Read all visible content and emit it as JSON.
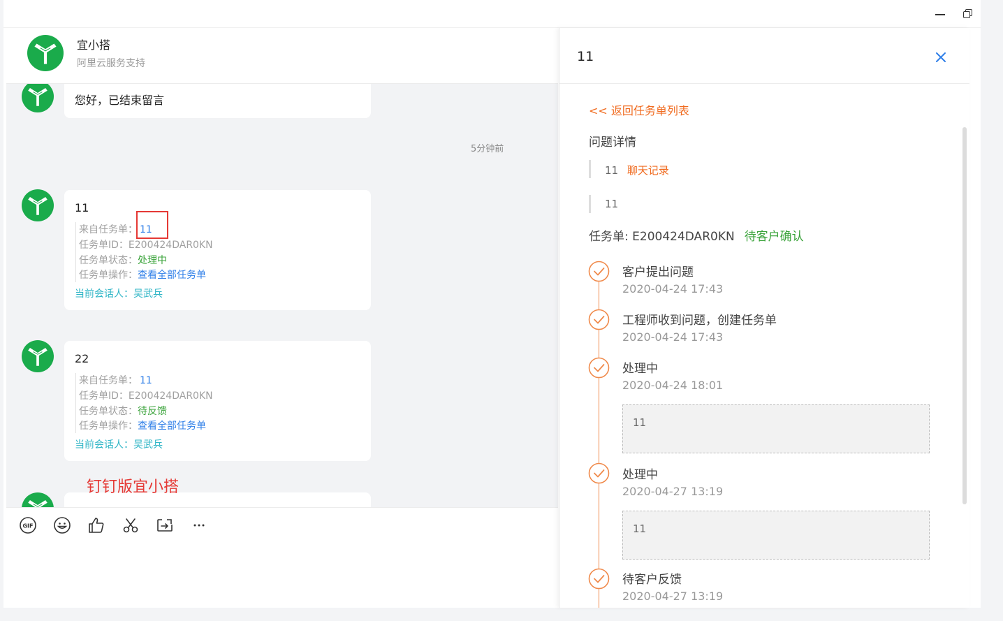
{
  "chat": {
    "header": {
      "name": "宜小搭",
      "subtitle": "阿里云服务支持"
    },
    "messages": [
      {
        "text": "您好，已结束留言"
      }
    ],
    "timestamp": "5分钟前",
    "cards": [
      {
        "title": "11",
        "from_label": "来自任务单：",
        "from_value": "11",
        "id_label": "任务单ID：",
        "id_value": "E200424DAR0KN",
        "status_label": "任务单状态：",
        "status_value": "处理中",
        "op_label": "任务单操作：",
        "op_value": "查看全部任务单",
        "speaker_label": "当前会话人：",
        "speaker_value": "吴武兵"
      },
      {
        "title": "22",
        "from_label": "来自任务单：",
        "from_value": "11",
        "id_label": "任务单ID：",
        "id_value": "E200424DAR0KN",
        "status_label": "任务单状态：",
        "status_value": "待反馈",
        "op_label": "任务单操作：",
        "op_value": "查看全部任务单",
        "speaker_label": "当前会话人：",
        "speaker_value": "吴武兵"
      }
    ],
    "watermark": "钉钉版宜小搭",
    "toolbar": [
      "gif-icon",
      "emoji-icon",
      "thumbs-up-icon",
      "scissors-icon",
      "forward-icon",
      "more-icon"
    ]
  },
  "detail": {
    "title": "11",
    "back_link": "<< 返回任务单列表",
    "section_title": "问题详情",
    "question_lines": [
      {
        "text": "11",
        "link": "聊天记录"
      },
      {
        "text": "11"
      }
    ],
    "task_label": "任务单: E200424DAR0KN",
    "task_status": "待客户确认",
    "timeline": [
      {
        "title": "客户提出问题",
        "time": "2020-04-24 17:43"
      },
      {
        "title": "工程师收到问题，创建任务单",
        "time": "2020-04-24 17:43"
      },
      {
        "title": "处理中",
        "time": "2020-04-24 18:01",
        "note": "11"
      },
      {
        "title": "处理中",
        "time": "2020-04-27 13:19",
        "note": "11"
      },
      {
        "title": "待客户反馈",
        "time": "2020-04-27 13:19"
      }
    ]
  },
  "colors": {
    "brand_green": "#1aab4b",
    "accent_orange": "#f06a1e",
    "link_blue": "#2f7fe8",
    "status_green": "#3aa33a"
  }
}
